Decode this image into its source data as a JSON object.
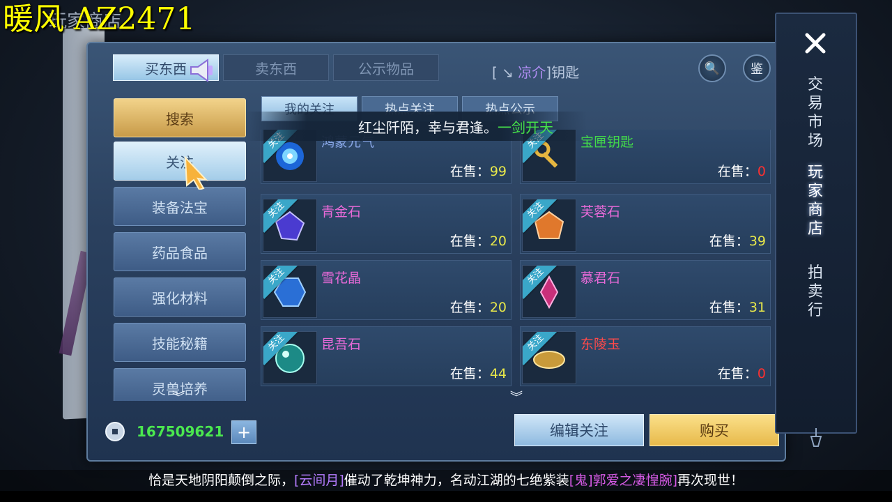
{
  "watermark": "暖风 AZ2471",
  "shop_title": "玩家商店",
  "top_tabs": [
    "买东西",
    "卖东西",
    "公示物品"
  ],
  "top_broadcast": {
    "prefix": "[ ↘ ",
    "player": "凉介",
    "suffix": "]钥匙"
  },
  "round_buttons": {
    "search_icon_label": "🔍",
    "appraise_label": "鉴"
  },
  "sidebar": {
    "items": [
      "搜索",
      "关注",
      "装备法宝",
      "药品食品",
      "强化材料",
      "技能秘籍",
      "灵兽培养"
    ]
  },
  "sub_tabs": [
    "我的关注",
    "热点关注",
    "热点公示"
  ],
  "notice": {
    "text": "红尘阡陌，幸与君逢。",
    "green_text": "一剑开天"
  },
  "sale_label": "在售：",
  "follow_tag": "关注",
  "items": [
    {
      "name": "鸿蒙元气",
      "count": "99",
      "name_color": "#8aa8e8",
      "gem": "nebula"
    },
    {
      "name": "宝匣钥匙",
      "count": "0",
      "name_color": "#42d94a",
      "gem": "key"
    },
    {
      "name": "青金石",
      "count": "20",
      "name_color": "#e86ad8",
      "gem": "lapis"
    },
    {
      "name": "芙蓉石",
      "count": "39",
      "name_color": "#e86ad8",
      "gem": "amber"
    },
    {
      "name": "雪花晶",
      "count": "20",
      "name_color": "#e86ad8",
      "gem": "sapphire"
    },
    {
      "name": "慕君石",
      "count": "31",
      "name_color": "#e86ad8",
      "gem": "amethyst"
    },
    {
      "name": "昆吾石",
      "count": "44",
      "name_color": "#e86ad8",
      "gem": "jade"
    },
    {
      "name": "东陵玉",
      "count": "0",
      "name_color": "#ff4a4a",
      "gem": "gold"
    }
  ],
  "currency": "167509621",
  "plus_label": "+",
  "edit_follow_label": "编辑关注",
  "buy_label": "购买",
  "right_nav": [
    "交易市场",
    "玩家商店",
    "拍卖行"
  ],
  "subtitle": {
    "part1": "恰是天地阴阳颠倒之际，",
    "part2": "[云间月]",
    "part3": "催动了乾坤神力，名动江湖的七绝紫装",
    "part4": "[鬼]郭爱之凄惶腕]",
    "part5": "再次现世！"
  }
}
